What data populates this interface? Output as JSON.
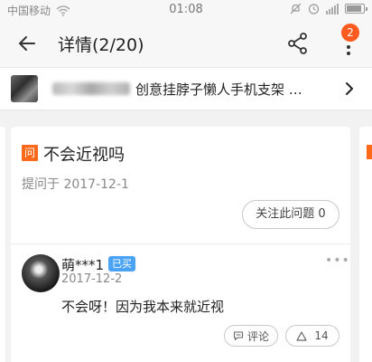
{
  "status_bar": {
    "carrier": "中国移动",
    "time": "01:08"
  },
  "header": {
    "title": "详情(2/20)",
    "badge_count": "2"
  },
  "product": {
    "title": "创意挂脖子懒人手机支架 …"
  },
  "question": {
    "icon_label": "问",
    "title": "不会近视吗",
    "date": "提问于 2017-12-1",
    "follow_label": "关注此问题 0"
  },
  "answer": {
    "author": "萌***1",
    "tag": "已买",
    "date": "2017-12-2",
    "text": "不会呀！因为我本来就近视",
    "comment_label": "评论",
    "like_count": "14"
  },
  "colors": {
    "accent": "#ff6a1a",
    "badge": "#ff5a1f",
    "tag_blue": "#4aa3f5"
  }
}
